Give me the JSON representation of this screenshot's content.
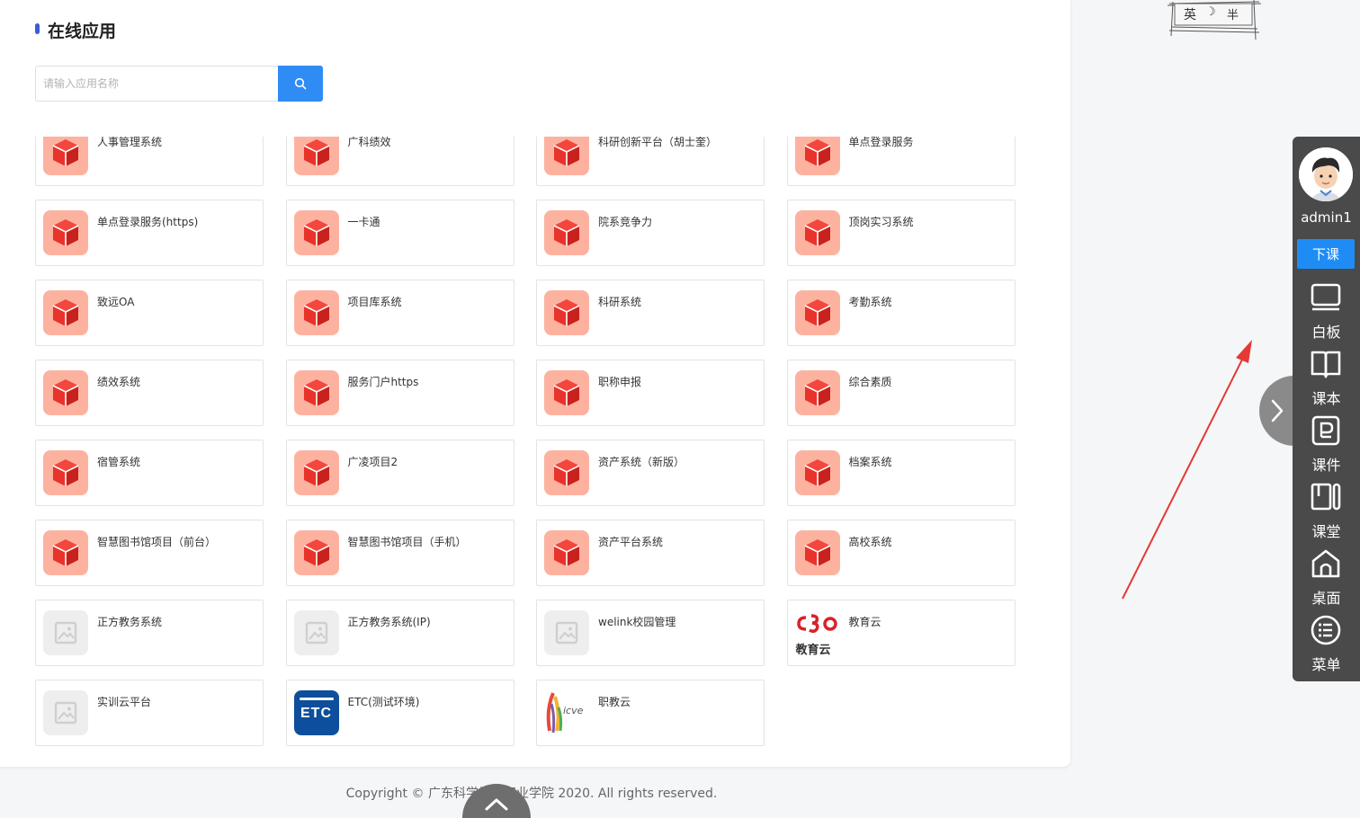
{
  "page": {
    "title": "在线应用",
    "search": {
      "placeholder": "请输入应用名称"
    },
    "apps": [
      {
        "label": "人事管理系统",
        "icon": "cube"
      },
      {
        "label": "广科绩效",
        "icon": "cube"
      },
      {
        "label": "科研创新平台（胡士奎）",
        "icon": "cube"
      },
      {
        "label": "单点登录服务",
        "icon": "cube"
      },
      {
        "label": "单点登录服务(https)",
        "icon": "cube"
      },
      {
        "label": "一卡通",
        "icon": "cube"
      },
      {
        "label": "院系竞争力",
        "icon": "cube"
      },
      {
        "label": "顶岗实习系统",
        "icon": "cube"
      },
      {
        "label": "致远OA",
        "icon": "cube"
      },
      {
        "label": "项目库系统",
        "icon": "cube"
      },
      {
        "label": "科研系统",
        "icon": "cube"
      },
      {
        "label": "考勤系统",
        "icon": "cube"
      },
      {
        "label": "绩效系统",
        "icon": "cube"
      },
      {
        "label": "服务门户https",
        "icon": "cube"
      },
      {
        "label": "职称申报",
        "icon": "cube"
      },
      {
        "label": "综合素质",
        "icon": "cube"
      },
      {
        "label": "宿管系统",
        "icon": "cube"
      },
      {
        "label": "广凌项目2",
        "icon": "cube"
      },
      {
        "label": "资产系统（新版）",
        "icon": "cube"
      },
      {
        "label": "档案系统",
        "icon": "cube"
      },
      {
        "label": "智慧图书馆项目（前台）",
        "icon": "cube"
      },
      {
        "label": "智慧图书馆项目（手机）",
        "icon": "cube"
      },
      {
        "label": "资产平台系统",
        "icon": "cube"
      },
      {
        "label": "高校系统",
        "icon": "cube"
      },
      {
        "label": "正方教务系统",
        "icon": "placeholder"
      },
      {
        "label": "正方教务系统(IP)",
        "icon": "placeholder"
      },
      {
        "label": "welink校园管理",
        "icon": "placeholder"
      },
      {
        "label": "教育云",
        "icon": "jiaoyuyun",
        "logo_text": "教育云"
      },
      {
        "label": "实训云平台",
        "icon": "placeholder"
      },
      {
        "label": "ETC(测试环境)",
        "icon": "etc",
        "logo_text": "ETC"
      },
      {
        "label": "职教云",
        "icon": "icve",
        "logo_text": "icve"
      }
    ],
    "footer": "Copyright © 广东科学技术职业学院 2020. All rights reserved."
  },
  "ime": {
    "chars": [
      "英",
      "☽",
      "半"
    ]
  },
  "sidebar": {
    "username": "admin1",
    "end_class_label": "下课",
    "items": [
      {
        "label": "白板",
        "icon": "whiteboard-icon"
      },
      {
        "label": "课本",
        "icon": "book-icon"
      },
      {
        "label": "课件",
        "icon": "courseware-icon"
      },
      {
        "label": "课堂",
        "icon": "classroom-icon"
      },
      {
        "label": "桌面",
        "icon": "desktop-home-icon"
      },
      {
        "label": "菜单",
        "icon": "menu-list-icon"
      }
    ]
  },
  "colors": {
    "accent": "#2f8cf5",
    "cube_bg": "#fdb2a0",
    "cube_red": "#e8332b",
    "sidebar_bg": "#4a4a4a",
    "arrow": "#e53935"
  }
}
